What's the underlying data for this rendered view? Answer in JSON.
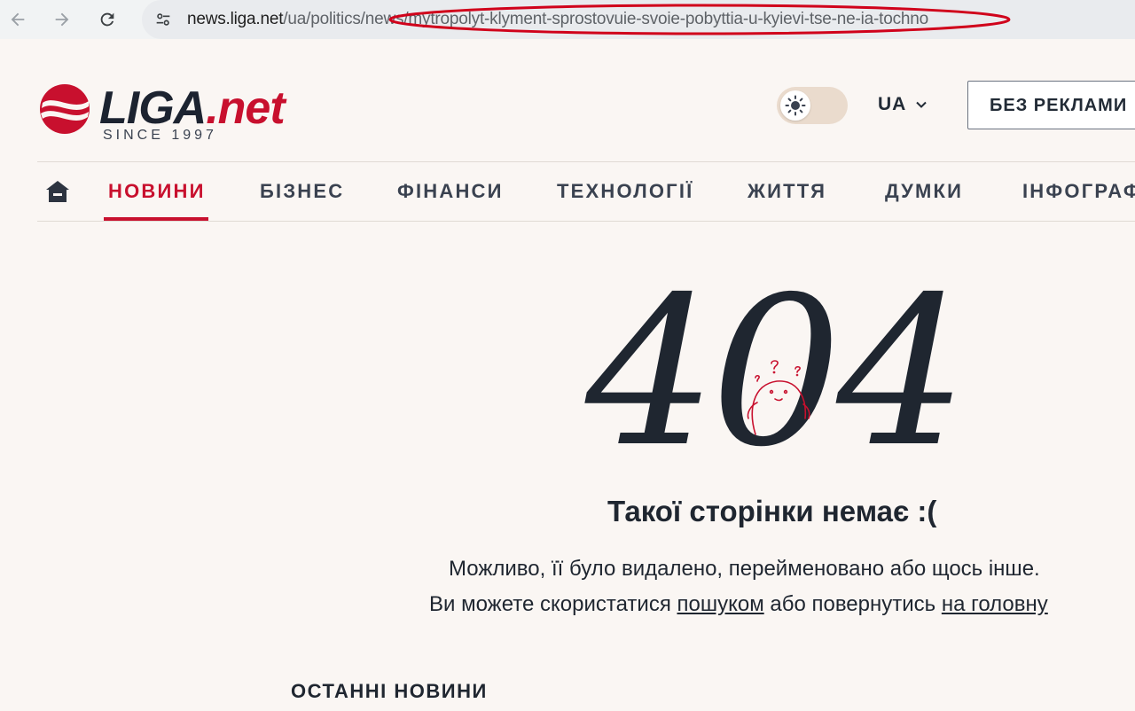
{
  "browser": {
    "url_host": "news.liga.net",
    "url_path": "/ua/politics/news/mytropolyt-klyment-sprostovuie-svoie-pobyttia-u-kyievi-tse-ne-ia-tochno",
    "annotation_color": "#d0021b"
  },
  "header": {
    "logo_main": "LIGA",
    "logo_suffix": ".net",
    "logo_since": "SINCE 1997",
    "theme_icon": "sun-icon",
    "language": "UA",
    "no_ads_label": "БЕЗ РЕКЛАМИ"
  },
  "nav": {
    "home_icon": "home-icon",
    "items": [
      {
        "label": "НОВИНИ",
        "active": true
      },
      {
        "label": "БІЗНЕС"
      },
      {
        "label": "ФІНАНСИ"
      },
      {
        "label": "ТЕХНОЛОГІЇ"
      },
      {
        "label": "ЖИТТЯ"
      },
      {
        "label": "ДУМКИ"
      },
      {
        "label": "ІНФОГРАФ"
      }
    ]
  },
  "error": {
    "code": "404",
    "title": "Такої сторінки немає :(",
    "desc_line1": "Можливо, її було видалено, перейменовано або щось інше.",
    "desc_line2_prefix": "Ви можете скористатися ",
    "search_link": "пошуком",
    "desc_line2_middle": " або повернутись ",
    "home_link": "на головну"
  },
  "latest_news": {
    "heading": "ОСТАННІ НОВИНИ"
  },
  "colors": {
    "brand_red": "#c8102e",
    "dark": "#1f2630",
    "page_bg": "#faf6f3"
  }
}
